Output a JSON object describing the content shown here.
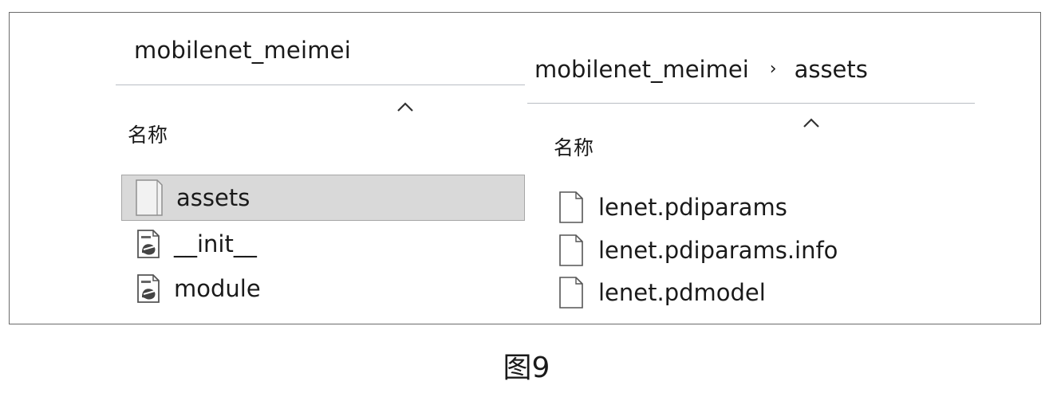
{
  "left_pane": {
    "title": "mobilenet_meimei",
    "column_header": "名称",
    "items": [
      {
        "name": "assets",
        "icon": "folder-icon",
        "selected": true
      },
      {
        "name": "__init__",
        "icon": "python-file-icon",
        "selected": false
      },
      {
        "name": "module",
        "icon": "python-file-icon",
        "selected": false
      }
    ]
  },
  "right_pane": {
    "breadcrumb": [
      "mobilenet_meimei",
      "assets"
    ],
    "breadcrumb_separator": "›",
    "column_header": "名称",
    "items": [
      {
        "name": "lenet.pdiparams",
        "icon": "file-icon"
      },
      {
        "name": "lenet.pdiparams.info",
        "icon": "file-icon"
      },
      {
        "name": "lenet.pdmodel",
        "icon": "file-icon"
      }
    ]
  },
  "caption": "图9",
  "colors": {
    "selection": "#d9d9d9",
    "frame_border": "#6b6b6b",
    "divider": "#b9bec4"
  }
}
